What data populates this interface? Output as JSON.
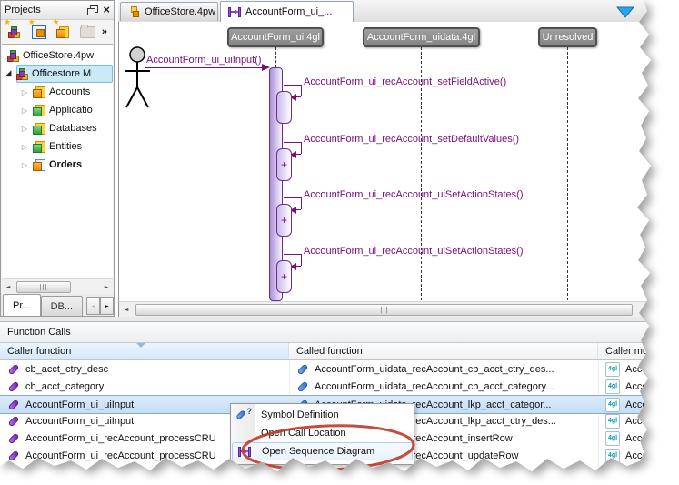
{
  "icons": {
    "collapsed": "▷",
    "expanded": "◢",
    "overflow": "»",
    "close": "×",
    "star": "★",
    "gl": "4gl",
    "question": "?",
    "scroll_left": "◄",
    "scroll_right": "►",
    "plus": "+"
  },
  "projects": {
    "title": "Projects",
    "root_label": "OfficeStore.4pw",
    "module_label": "Officestore M",
    "items": [
      {
        "label": "Accounts"
      },
      {
        "label": "Applicatio"
      },
      {
        "label": "Databases"
      },
      {
        "label": "Entities"
      },
      {
        "label": "Orders"
      }
    ],
    "tab_projects": "Pr...",
    "tab_db": "DB..."
  },
  "editor": {
    "tab_project": "OfficeStore.4pw",
    "tab_diagram": "AccountForm_ui_..."
  },
  "diagram": {
    "actor_message": "AccountForm_ui_uiInput()",
    "lifelines": [
      {
        "label": "AccountForm_ui.4gl"
      },
      {
        "label": "AccountForm_uidata.4gl"
      },
      {
        "label": "Unresolved"
      }
    ],
    "calls": [
      {
        "label": "AccountForm_ui_recAccount_setFieldActive()",
        "plus": ""
      },
      {
        "label": "AccountForm_ui_recAccount_setDefaultValues()",
        "plus": "+"
      },
      {
        "label": "AccountForm_ui_recAccount_uiSetActionStates()",
        "plus": "+"
      },
      {
        "label": "AccountForm_ui_recAccount_uiSetActionStates()",
        "plus": "+"
      }
    ]
  },
  "function_calls": {
    "title": "Function Calls",
    "columns": [
      {
        "label": "Caller function"
      },
      {
        "label": "Called function"
      },
      {
        "label": "Caller module"
      }
    ],
    "rows": [
      {
        "caller": "cb_acct_ctry_desc",
        "called": "AccountForm_uidata_recAccount_cb_acct_ctry_des...",
        "module": "AccountForm"
      },
      {
        "caller": "cb_acct_category",
        "called": "AccountForm_uidata_recAccount_cb_acct_category...",
        "module": "AccountForm"
      },
      {
        "caller": "AccountForm_ui_uiInput",
        "called": "AccountForm_uidata_recAccount_lkp_acct_categor...",
        "module": "AccountForm"
      },
      {
        "caller": "AccountForm_ui_uiInput",
        "called": "AccountForm_uidata_recAccount_lkp_acct_ctry_des...",
        "module": "AccountForm"
      },
      {
        "caller": "AccountForm_ui_recAccount_processCRU",
        "called": "AccountForm_uidata_recAccount_insertRow",
        "module": "AccountForm"
      },
      {
        "caller": "AccountForm_ui_recAccount_processCRU",
        "called": "AccountForm_uidata_recAccount_updateRow",
        "module": "AccountForm"
      }
    ]
  },
  "menu": {
    "items": [
      {
        "label": "Symbol Definition"
      },
      {
        "label": "Open Call Location"
      },
      {
        "label": "Open Sequence Diagram"
      }
    ]
  },
  "colors": {
    "diagram_purple": "#7d0c7d",
    "lifeline_header_bg": "#8f8f8f",
    "tree_selection": "#cbe8f6",
    "row_selection": "#c4def5",
    "annotation_red": "#bf3a2b",
    "tab_arrow_blue": "#2aa3e8"
  }
}
